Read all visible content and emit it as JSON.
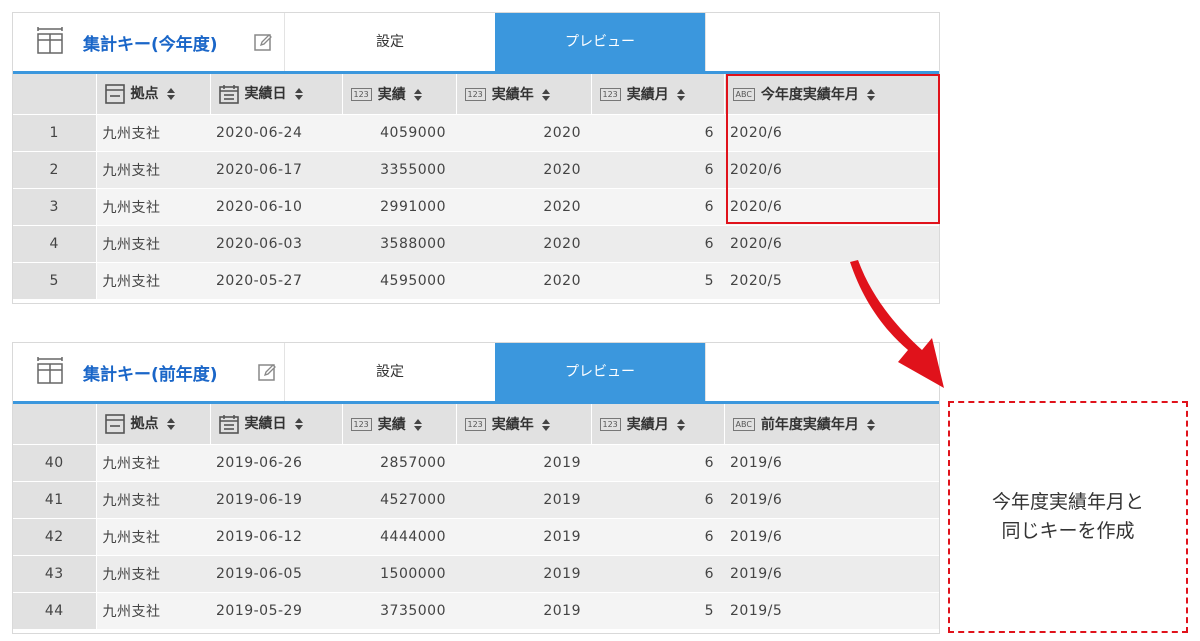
{
  "panels": [
    {
      "title": "集計キー(今年度)",
      "tabs": {
        "settings": "設定",
        "preview": "プレビュー"
      },
      "columns": [
        "拠点",
        "実績日",
        "実績",
        "実績年",
        "実績月",
        "今年度実績年月"
      ],
      "rows": [
        {
          "n": "1",
          "c": [
            "九州支社",
            "2020-06-24",
            "4059000",
            "2020",
            "6",
            "2020/6"
          ]
        },
        {
          "n": "2",
          "c": [
            "九州支社",
            "2020-06-17",
            "3355000",
            "2020",
            "6",
            "2020/6"
          ]
        },
        {
          "n": "3",
          "c": [
            "九州支社",
            "2020-06-10",
            "2991000",
            "2020",
            "6",
            "2020/6"
          ]
        },
        {
          "n": "4",
          "c": [
            "九州支社",
            "2020-06-03",
            "3588000",
            "2020",
            "6",
            "2020/6"
          ]
        },
        {
          "n": "5",
          "c": [
            "九州支社",
            "2020-05-27",
            "4595000",
            "2020",
            "5",
            "2020/5"
          ]
        }
      ]
    },
    {
      "title": "集計キー(前年度)",
      "tabs": {
        "settings": "設定",
        "preview": "プレビュー"
      },
      "columns": [
        "拠点",
        "実績日",
        "実績",
        "実績年",
        "実績月",
        "前年度実績年月"
      ],
      "rows": [
        {
          "n": "40",
          "c": [
            "九州支社",
            "2019-06-26",
            "2857000",
            "2019",
            "6",
            "2019/6"
          ]
        },
        {
          "n": "41",
          "c": [
            "九州支社",
            "2019-06-19",
            "4527000",
            "2019",
            "6",
            "2019/6"
          ]
        },
        {
          "n": "42",
          "c": [
            "九州支社",
            "2019-06-12",
            "4444000",
            "2019",
            "6",
            "2019/6"
          ]
        },
        {
          "n": "43",
          "c": [
            "九州支社",
            "2019-06-05",
            "1500000",
            "2019",
            "6",
            "2019/6"
          ]
        },
        {
          "n": "44",
          "c": [
            "九州支社",
            "2019-05-29",
            "3735000",
            "2019",
            "5",
            "2019/5"
          ]
        }
      ]
    }
  ],
  "column_type_icons": [
    "text-icon",
    "calendar-icon",
    "number-icon",
    "number-icon",
    "number-icon",
    "string-icon"
  ],
  "type_badges": {
    "number": "123",
    "string": "ABC"
  },
  "callout": {
    "line1": "今年度実績年月と",
    "line2": "同じキーを作成"
  },
  "colors": {
    "accent": "#3b97dd",
    "title": "#1a66c8",
    "highlight": "#e0121b"
  }
}
